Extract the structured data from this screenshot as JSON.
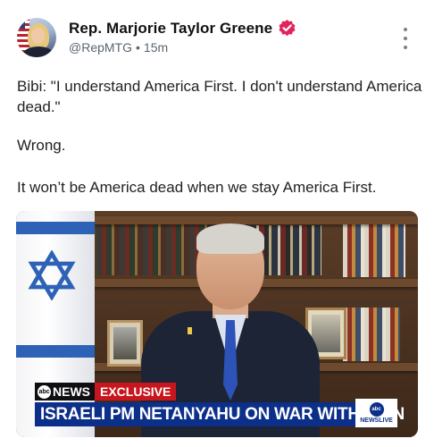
{
  "post": {
    "display_name": "Rep. Marjorie Taylor Greene",
    "handle": "@RepMTG",
    "separator": "•",
    "timestamp": "15m",
    "text_lines": [
      "Bibi: \"I understand America First. I don't understand America dead.\"",
      "Wrong.",
      "It won’t be America dead when we stay America First."
    ]
  },
  "icons": {
    "verified": "verified-badge-icon",
    "more": "more-options-icon",
    "avatar": "avatar"
  },
  "media": {
    "chyron_brand": "NEWS",
    "chyron_brand_logo": "abc",
    "chyron_tag": "EXCLUSIVE",
    "chyron_headline": "ISRAELI PM NETANYAHU ON WAR WITH IRAN",
    "corner_logo": "abc",
    "corner_label": "NEWSLIVE"
  },
  "colors": {
    "verified": "#e0245e",
    "chyron_blue": "#0c2f8a",
    "chyron_red": "#c7161d",
    "flag_blue": "#2e62b6"
  }
}
